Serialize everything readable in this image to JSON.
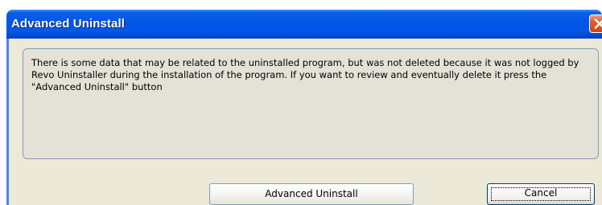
{
  "window": {
    "title": "Advanced Uninstall"
  },
  "message": {
    "text": "There is some data that may be related to the uninstalled program, but was not deleted because it was not logged by Revo Uninstaller during the installation of the program. If you want to review and eventually delete it press the \"Advanced Uninstall\" button"
  },
  "buttons": {
    "advanced_label": "Advanced Uninstall",
    "cancel_label": "Cancel"
  },
  "colors": {
    "titlebar": "#0055e5",
    "close_button": "#e2592d",
    "client_bg": "#ece9d8"
  },
  "icons": {
    "close": "close-icon"
  }
}
